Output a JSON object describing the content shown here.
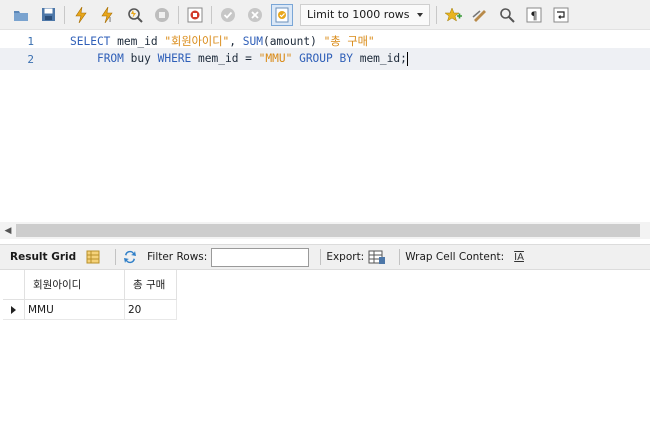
{
  "toolbar": {
    "limit_select": "Limit to 1000 rows",
    "icons": [
      "open-folder-icon",
      "save-icon",
      "execute-icon",
      "execute-current-icon",
      "explain-icon",
      "stop-icon",
      "toggle-continue-icon",
      "commit-icon",
      "rollback-icon",
      "autocommit-icon",
      "bookmark-icon",
      "beautify-icon",
      "find-icon",
      "invisible-chars-icon",
      "wrap-icon"
    ]
  },
  "editor": {
    "lines": [
      {
        "no": "1"
      },
      {
        "no": "2"
      }
    ],
    "tokens": {
      "select": "SELECT",
      "mem_id1": " mem_id ",
      "alias1": "\"회원아이디\"",
      "comma": ", ",
      "sum": "SUM",
      "amount": "(amount) ",
      "alias2": "\"총 구매\"",
      "indent": "    ",
      "from": "FROM",
      "buy": " buy ",
      "where": "WHERE",
      "mem_id2": " mem_id = ",
      "mmu": "\"MMU\"",
      "sp": " ",
      "groupby": "GROUP BY",
      "mem_id3": " mem_id;"
    }
  },
  "result_bar": {
    "tab_label": "Result Grid",
    "filter_label": "Filter Rows:",
    "filter_value": "",
    "export_label": "Export:",
    "wrap_label": "Wrap Cell Content:",
    "wrap_icon_text": "IA"
  },
  "grid": {
    "columns": [
      "회원아이디",
      "총 구매"
    ],
    "rows": [
      [
        "MMU",
        "20"
      ]
    ]
  },
  "colors": {
    "keyword": "#2f5fb8",
    "string": "#d98a16",
    "line_number": "#3a6fb0"
  }
}
